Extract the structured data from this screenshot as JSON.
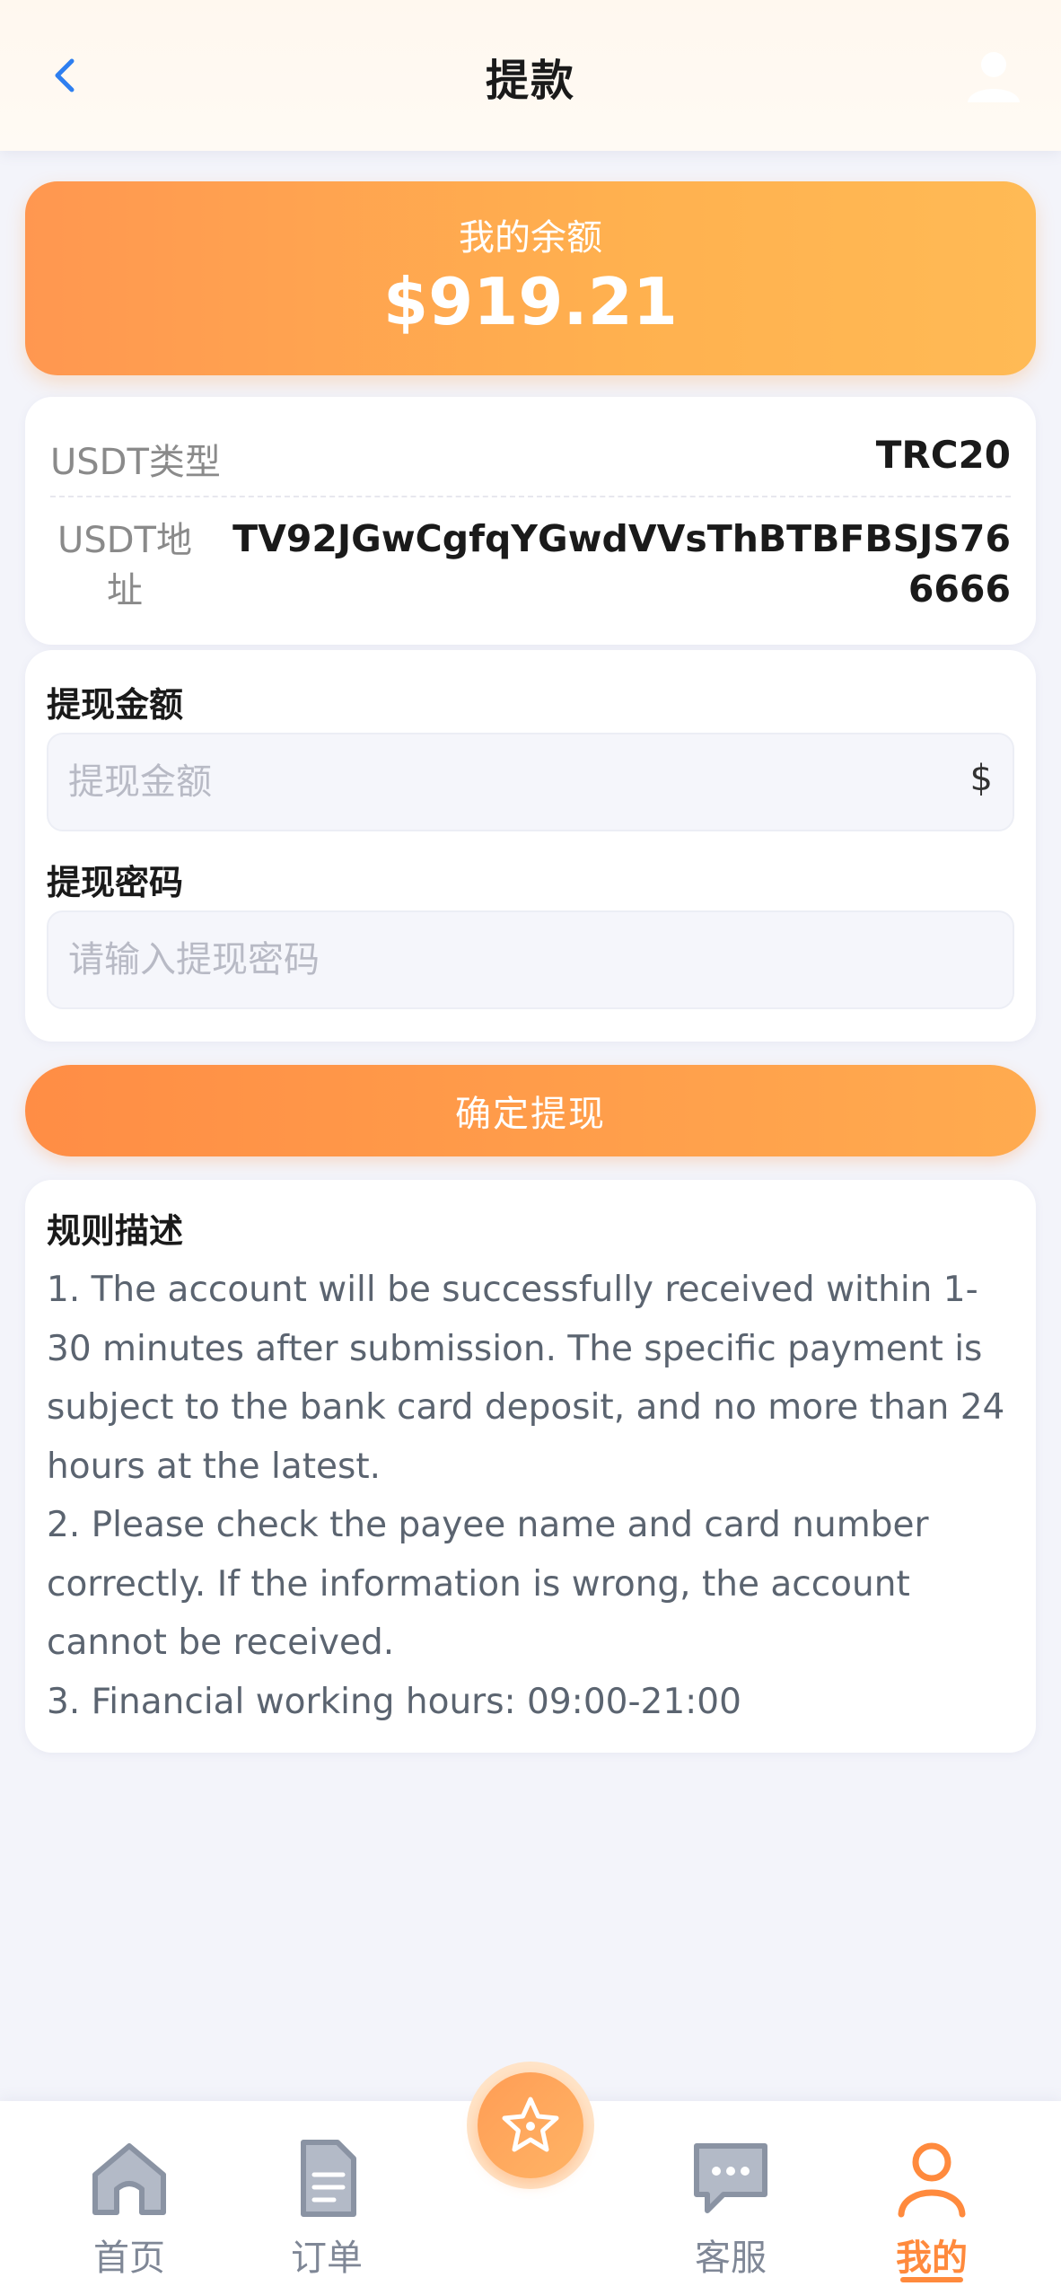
{
  "header": {
    "title": "提款"
  },
  "balance": {
    "label": "我的余额",
    "value": "$919.21"
  },
  "usdt": {
    "type_label": "USDT类型",
    "type_value": "TRC20",
    "address_label": "USDT地址",
    "address_value": "TV92JGwCgfqYGwdVVsThBTBFBSJS766666"
  },
  "form": {
    "amount_label": "提现金额",
    "amount_placeholder": "提现金额",
    "amount_suffix": "$",
    "password_label": "提现密码",
    "password_placeholder": "请输入提现密码"
  },
  "confirm_button": "确定提现",
  "rules": {
    "title": "规则描述",
    "items": [
      "1. The account will be successfully received within 1-30 minutes after submission. The specific payment is subject to the bank card deposit, and no more than 24 hours at the latest.",
      "2. Please check the payee name and card number correctly. If the information is wrong, the account cannot be received.",
      "3. Financial working hours: 09:00-21:00"
    ]
  },
  "tabbar": {
    "items": [
      {
        "label": "首页",
        "icon": "home-icon"
      },
      {
        "label": "订单",
        "icon": "document-icon"
      },
      {
        "label": "客服",
        "icon": "chat-icon"
      },
      {
        "label": "我的",
        "icon": "user-icon",
        "active": true
      }
    ],
    "center_icon": "star-icon"
  },
  "colors": {
    "accent": "#ff8a3d",
    "accent_light": "#ffb14f",
    "background": "#f3f4fa"
  }
}
